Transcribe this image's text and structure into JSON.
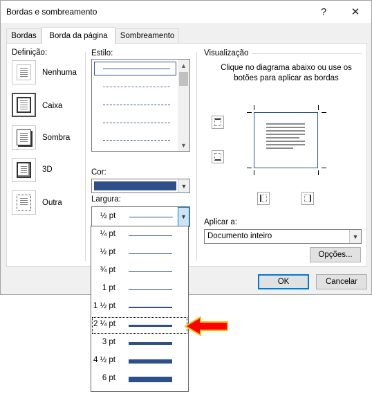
{
  "window": {
    "title": "Bordas e sombreamento",
    "help_glyph": "?",
    "close_glyph": "✕"
  },
  "tabs": [
    {
      "label": "Bordas",
      "active": false
    },
    {
      "label": "Borda da página",
      "active": true
    },
    {
      "label": "Sombreamento",
      "active": false
    }
  ],
  "definition": {
    "label": "Definição:",
    "items": [
      {
        "label": "Nenhuma",
        "selected": false,
        "icon": "page-none-icon"
      },
      {
        "label": "Caixa",
        "selected": true,
        "icon": "page-box-icon"
      },
      {
        "label": "Sombra",
        "selected": false,
        "icon": "page-shadow-icon"
      },
      {
        "label": "3D",
        "selected": false,
        "icon": "page-3d-icon"
      },
      {
        "label": "Outra",
        "selected": false,
        "icon": "page-custom-icon"
      }
    ]
  },
  "style": {
    "label": "Estilo:"
  },
  "color": {
    "label": "Cor:",
    "value": "#2d4f8a"
  },
  "width": {
    "label": "Largura:",
    "selected": "½ pt",
    "options": [
      "¼ pt",
      "½ pt",
      "¾ pt",
      "1 pt",
      "1 ½ pt",
      "2 ¼ pt",
      "3 pt",
      "4 ½ pt",
      "6 pt"
    ],
    "highlighted": "2 ¼ pt"
  },
  "preview": {
    "label": "Visualização",
    "hint": "Clique no diagrama abaixo ou use os botões para aplicar as bordas"
  },
  "apply_to": {
    "label": "Aplicar a:",
    "value": "Documento inteiro"
  },
  "buttons": {
    "options": "Opções...",
    "ok": "OK",
    "cancel": "Cancelar"
  },
  "colors": {
    "accent": "#0078d7",
    "border_blue": "#2d4f8a",
    "arrow_red": "#ff0000",
    "arrow_outline": "#ffc000"
  }
}
